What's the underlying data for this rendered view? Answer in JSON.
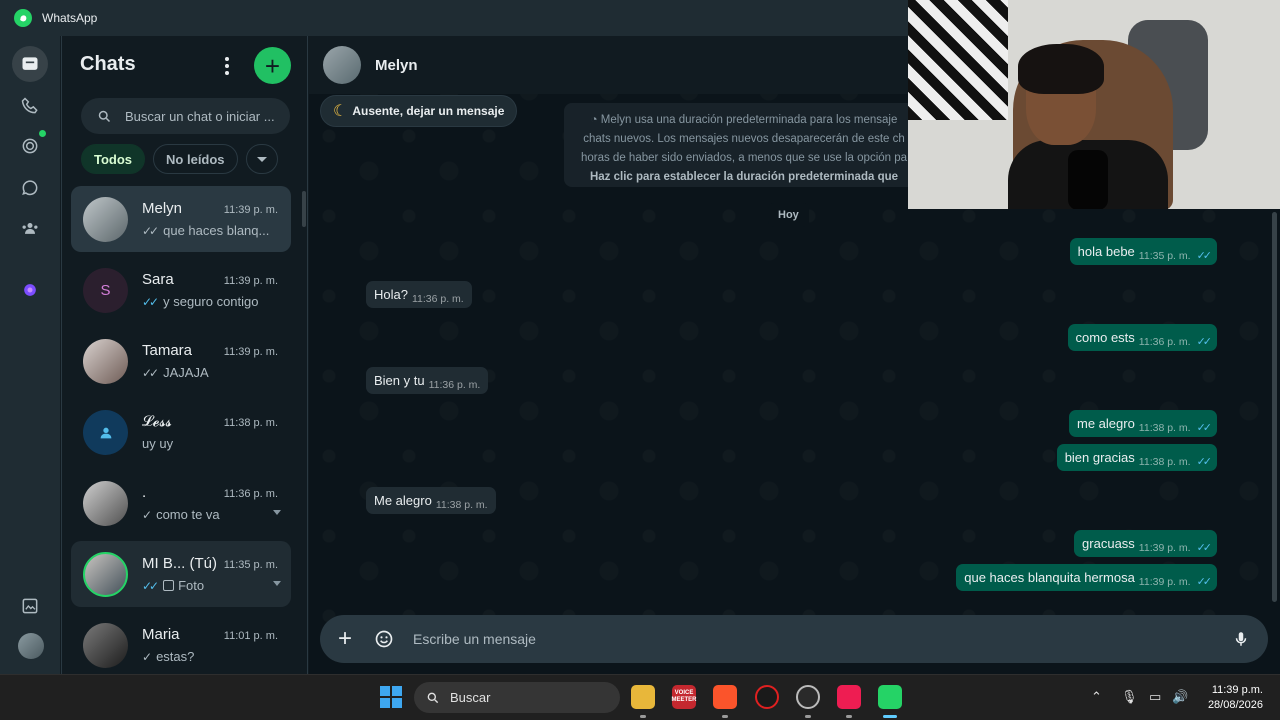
{
  "window": {
    "title": "WhatsApp"
  },
  "sidebar": {
    "title": "Chats",
    "search_placeholder": "Buscar un chat o iniciar ...",
    "filters": [
      "Todos",
      "No leídos"
    ],
    "chats": [
      {
        "name": "Melyn",
        "time": "11:39 p. m.",
        "preview": "que haces blanq...",
        "tick": "read"
      },
      {
        "name": "Sara",
        "time": "11:39 p. m.",
        "preview": "y seguro contigo",
        "tick": "read",
        "avatar_letter": "S"
      },
      {
        "name": "Tamara",
        "time": "11:39 p. m.",
        "preview": "JAJAJA",
        "tick": "delivered"
      },
      {
        "name": "𝓛𝓮𝓼𝓼",
        "time": "11:38 p. m.",
        "preview": "uy uy",
        "tick": "none"
      },
      {
        "name": ".",
        "time": "11:36 p. m.",
        "preview": "como te va",
        "tick": "sent"
      },
      {
        "name": "MI B... (Tú)",
        "time": "11:35 p. m.",
        "preview": "Foto",
        "tick": "read"
      },
      {
        "name": "Maria",
        "time": "11:01 p. m.",
        "preview": "estas?",
        "tick": "sent"
      }
    ]
  },
  "conversation": {
    "contact_name": "Melyn",
    "away_label": "Ausente, dejar un mensaje",
    "system_note": {
      "text": "Melyn usa una duración predeterminada para los mensaje chats nuevos. Los mensajes nuevos desaparecerán de este ch horas de haber sido enviados, a menos que se use la opción pa",
      "link": "Haz clic para establecer la duración predeterminada que"
    },
    "day": "Hoy",
    "messages": [
      {
        "dir": "out",
        "text": "hola bebe",
        "time": "11:35 p. m."
      },
      {
        "dir": "in",
        "text": "Hola?",
        "time": "11:36 p. m."
      },
      {
        "dir": "out",
        "text": "como ests",
        "time": "11:36 p. m."
      },
      {
        "dir": "in",
        "text": "Bien y tu",
        "time": "11:36 p. m."
      },
      {
        "dir": "out",
        "text": "me alegro",
        "time": "11:38 p. m."
      },
      {
        "dir": "out",
        "text": "bien gracias",
        "time": "11:38 p. m."
      },
      {
        "dir": "in",
        "text": "Me alegro",
        "time": "11:38 p. m."
      },
      {
        "dir": "out",
        "text": "gracuass",
        "time": "11:39 p. m."
      },
      {
        "dir": "out",
        "text": "que haces blanquita hermosa",
        "time": "11:39 p. m."
      }
    ],
    "composer_placeholder": "Escribe un mensaje"
  },
  "taskbar": {
    "search_label": "Buscar",
    "voicemeeter_label": "VOICE MEETER",
    "clock_time": "11:39 p.m.",
    "clock_date": "28/08/2026"
  },
  "colors": {
    "accent": "#21c063",
    "outgoing_bubble": "#005c4b",
    "incoming_bubble": "#202c33",
    "background": "#0b141a",
    "read_tick": "#53bdeb"
  }
}
